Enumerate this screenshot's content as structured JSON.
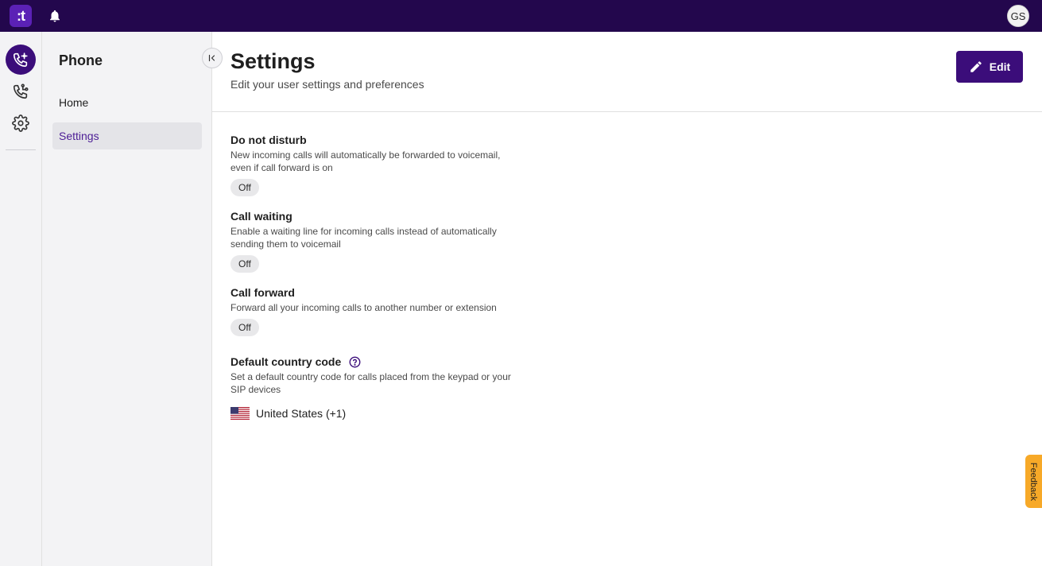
{
  "topbar": {
    "logo_text": ":t",
    "avatar_initials": "GS"
  },
  "subnav": {
    "title": "Phone",
    "items": [
      {
        "label": "Home",
        "active": false
      },
      {
        "label": "Settings",
        "active": true
      }
    ]
  },
  "main": {
    "title": "Settings",
    "subtitle": "Edit your user settings and preferences",
    "edit_label": "Edit",
    "settings": [
      {
        "name": "Do not disturb",
        "desc1": "New incoming calls will automatically be forwarded to voicemail,",
        "desc2": "even if call forward is on",
        "value": "Off"
      },
      {
        "name": "Call waiting",
        "desc1": "Enable a waiting line for incoming calls instead of automatically",
        "desc2": "sending them to voicemail",
        "value": "Off"
      },
      {
        "name": "Call forward",
        "desc1": "Forward all your incoming calls to another number or extension",
        "desc2": "",
        "value": "Off"
      }
    ],
    "country_code": {
      "name": "Default country code",
      "desc1": "Set a default country code for calls placed from the keypad or your",
      "desc2": "SIP devices",
      "value": "United States (+1)"
    }
  },
  "feedback_label": "Feedback",
  "colors": {
    "topbar": "#23074d",
    "accent": "#3b0d7a",
    "feedback": "#f7a928"
  }
}
